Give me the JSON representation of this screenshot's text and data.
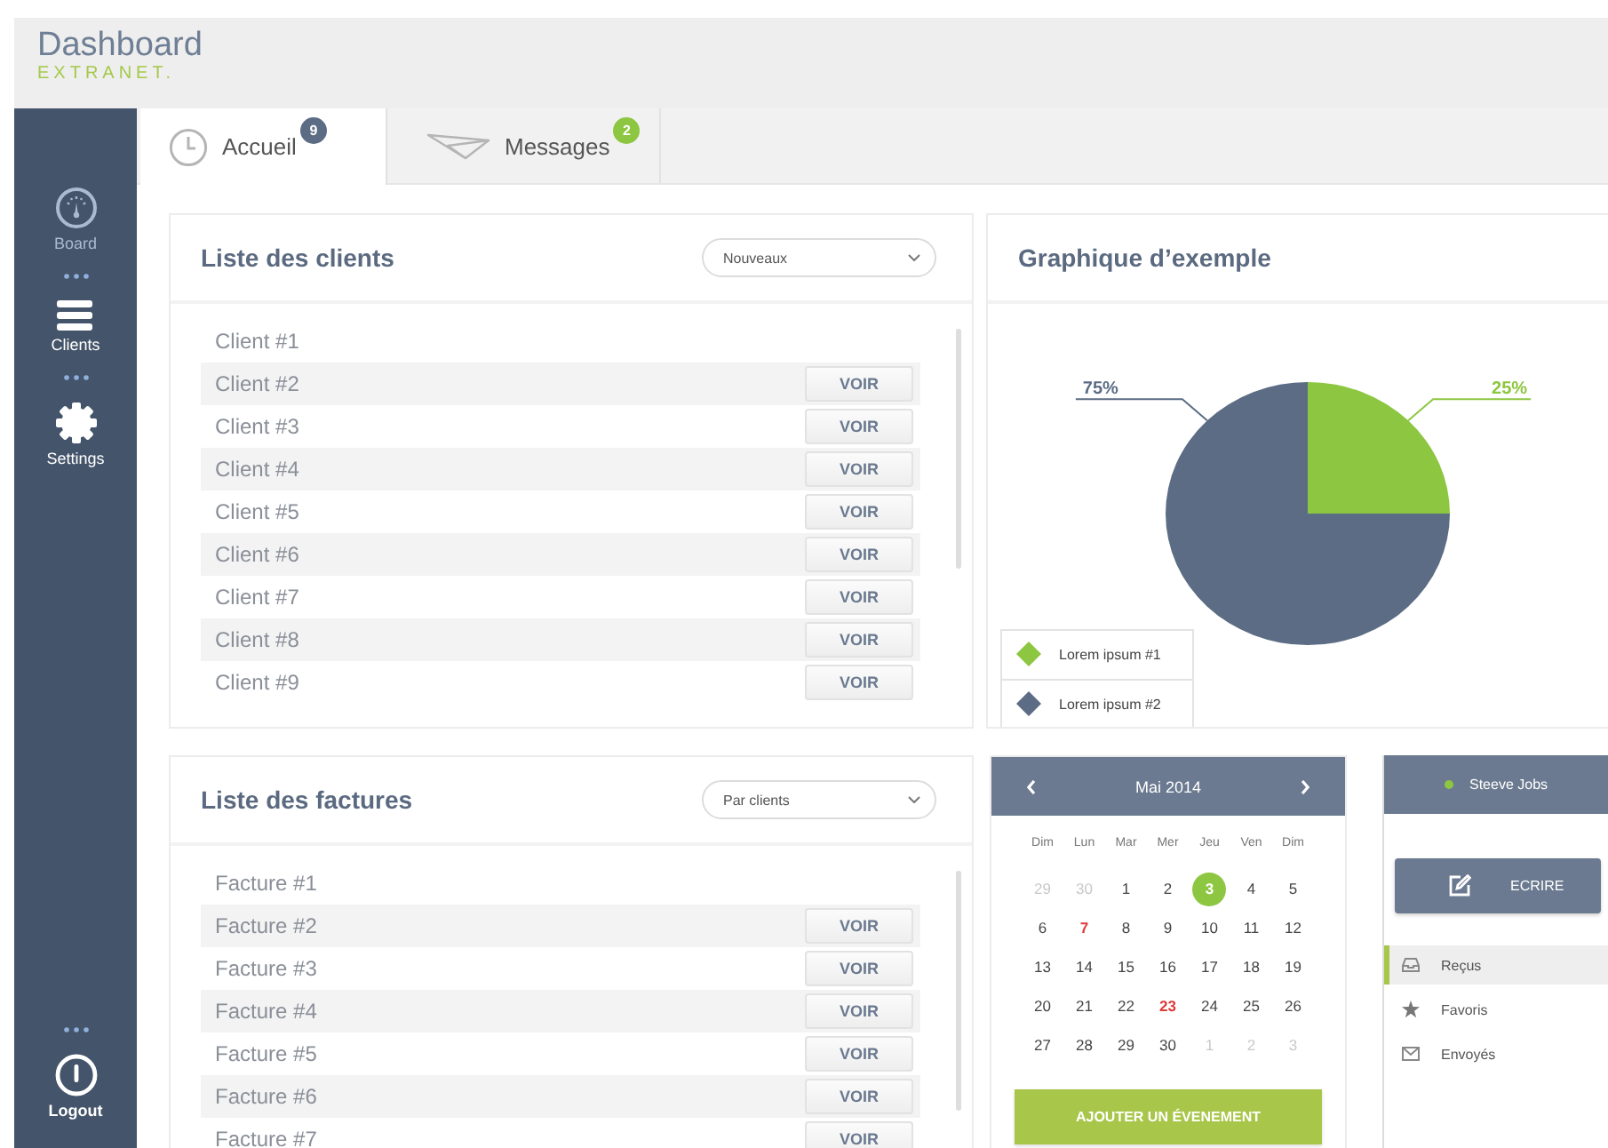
{
  "header": {
    "title": "Dashboard",
    "subtitle": "EXTRANET."
  },
  "sidebar": {
    "items": [
      {
        "label": "Board",
        "selected": true
      },
      {
        "label": "Clients",
        "selected": false
      },
      {
        "label": "Settings",
        "selected": false
      }
    ],
    "logout": "Logout"
  },
  "tabs": [
    {
      "label": "Accueil",
      "badge": "9",
      "color": "#5b6c84",
      "selected": true
    },
    {
      "label": "Messages",
      "badge": "2",
      "color": "#8dc641",
      "selected": false
    }
  ],
  "clients": {
    "title": "Liste des clients",
    "filter": "Nouveaux",
    "rows": [
      {
        "name": "Client #1"
      },
      {
        "name": "Client #2",
        "action": "VOIR"
      },
      {
        "name": "Client #3",
        "action": "VOIR"
      },
      {
        "name": "Client #4",
        "action": "VOIR"
      },
      {
        "name": "Client #5",
        "action": "VOIR"
      },
      {
        "name": "Client #6",
        "action": "VOIR"
      },
      {
        "name": "Client #7",
        "action": "VOIR"
      },
      {
        "name": "Client #8",
        "action": "VOIR"
      },
      {
        "name": "Client #9",
        "action": "VOIR"
      }
    ]
  },
  "chart": {
    "title": "Graphique d’exemple",
    "chart_data": {
      "type": "pie",
      "categories": [
        "Lorem ipsum #1",
        "Lorem ipsum #2"
      ],
      "values": [
        25,
        75
      ],
      "colors": [
        "#8dc641",
        "#5b6c84"
      ],
      "value_labels": [
        "25%",
        "75%"
      ],
      "legend": "lower left"
    }
  },
  "invoices": {
    "title": "Liste des factures",
    "filter": "Par clients",
    "rows": [
      {
        "name": "Facture #1"
      },
      {
        "name": "Facture #2",
        "action": "VOIR"
      },
      {
        "name": "Facture #3",
        "action": "VOIR"
      },
      {
        "name": "Facture #4",
        "action": "VOIR"
      },
      {
        "name": "Facture #5",
        "action": "VOIR"
      },
      {
        "name": "Facture #6",
        "action": "VOIR"
      },
      {
        "name": "Facture #7",
        "action": "VOIR"
      }
    ]
  },
  "calendar": {
    "month": "Mai 2014",
    "weekdays": [
      "Dim",
      "Lun",
      "Mar",
      "Mer",
      "Jeu",
      "Ven",
      "Dim"
    ],
    "days": [
      {
        "day": "29",
        "kind": "outside",
        "selected": false
      },
      {
        "day": "30",
        "kind": "outside",
        "selected": false
      },
      {
        "day": "1",
        "kind": "day",
        "selected": false
      },
      {
        "day": "2",
        "kind": "day",
        "selected": false
      },
      {
        "day": "3",
        "kind": "day",
        "selected": true
      },
      {
        "day": "4",
        "kind": "day",
        "selected": false
      },
      {
        "day": "5",
        "kind": "day",
        "selected": false
      },
      {
        "day": "6",
        "kind": "day",
        "selected": false
      },
      {
        "day": "7",
        "kind": "event",
        "selected": false
      },
      {
        "day": "8",
        "kind": "day",
        "selected": false
      },
      {
        "day": "9",
        "kind": "day",
        "selected": false
      },
      {
        "day": "10",
        "kind": "day",
        "selected": false
      },
      {
        "day": "11",
        "kind": "day",
        "selected": false
      },
      {
        "day": "12",
        "kind": "day",
        "selected": false
      },
      {
        "day": "13",
        "kind": "day",
        "selected": false
      },
      {
        "day": "14",
        "kind": "day",
        "selected": false
      },
      {
        "day": "15",
        "kind": "day",
        "selected": false
      },
      {
        "day": "16",
        "kind": "day",
        "selected": false
      },
      {
        "day": "17",
        "kind": "day",
        "selected": false
      },
      {
        "day": "18",
        "kind": "day",
        "selected": false
      },
      {
        "day": "19",
        "kind": "day",
        "selected": false
      },
      {
        "day": "20",
        "kind": "day",
        "selected": false
      },
      {
        "day": "21",
        "kind": "day",
        "selected": false
      },
      {
        "day": "22",
        "kind": "day",
        "selected": false
      },
      {
        "day": "23",
        "kind": "event",
        "selected": false
      },
      {
        "day": "24",
        "kind": "day",
        "selected": false
      },
      {
        "day": "25",
        "kind": "day",
        "selected": false
      },
      {
        "day": "26",
        "kind": "day",
        "selected": false
      },
      {
        "day": "27",
        "kind": "day",
        "selected": false
      },
      {
        "day": "28",
        "kind": "day",
        "selected": false
      },
      {
        "day": "29",
        "kind": "day",
        "selected": false
      },
      {
        "day": "30",
        "kind": "day",
        "selected": false
      },
      {
        "day": "1",
        "kind": "outside",
        "selected": false
      },
      {
        "day": "2",
        "kind": "outside",
        "selected": false
      },
      {
        "day": "3",
        "kind": "outside",
        "selected": false
      }
    ],
    "add_button": "AJOUTER UN ÉVENEMENT"
  },
  "mail": {
    "user": {
      "name": "Steeve Jobs",
      "online": true
    },
    "compose": "ECRIRE",
    "folders": [
      {
        "label": "Reçus",
        "selected": true
      },
      {
        "label": "Favoris",
        "selected": false
      },
      {
        "label": "Envoyés",
        "selected": false
      }
    ]
  }
}
